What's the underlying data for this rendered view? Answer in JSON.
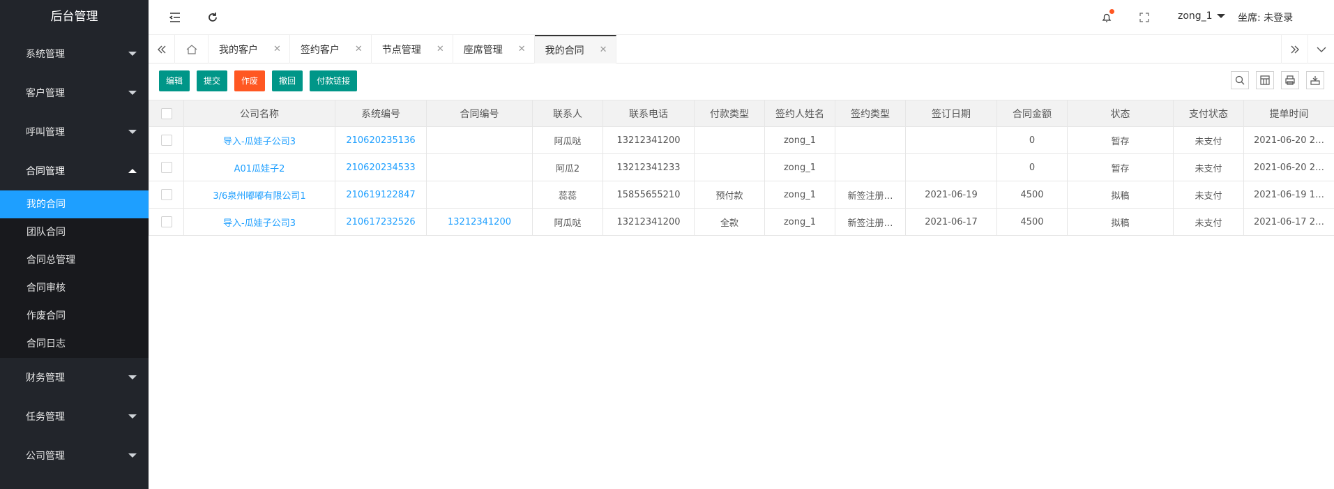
{
  "app": {
    "title": "后台管理"
  },
  "sidebar": {
    "groups": [
      {
        "label": "系统管理"
      },
      {
        "label": "客户管理"
      },
      {
        "label": "呼叫管理"
      },
      {
        "label": "合同管理"
      },
      {
        "label": "财务管理"
      },
      {
        "label": "任务管理"
      },
      {
        "label": "公司管理"
      }
    ],
    "contract_sub": [
      {
        "label": "我的合同"
      },
      {
        "label": "团队合同"
      },
      {
        "label": "合同总管理"
      },
      {
        "label": "合同审核"
      },
      {
        "label": "作废合同"
      },
      {
        "label": "合同日志"
      }
    ]
  },
  "header": {
    "user": "zong_1",
    "seat": "坐席: 未登录",
    "accent_color": "#ff5722"
  },
  "tabs": [
    {
      "label": "我的客户"
    },
    {
      "label": "签约客户"
    },
    {
      "label": "节点管理"
    },
    {
      "label": "座席管理"
    },
    {
      "label": "我的合同"
    }
  ],
  "toolbar": {
    "edit": "编辑",
    "submit": "提交",
    "void": "作废",
    "withdraw": "撤回",
    "pay_link": "付款链接"
  },
  "table": {
    "headers": [
      "公司名称",
      "系统编号",
      "合同编号",
      "联系人",
      "联系电话",
      "付款类型",
      "签约人姓名",
      "签约类型",
      "签订日期",
      "合同金额",
      "状态",
      "支付状态",
      "提单时间"
    ],
    "rows": [
      [
        "导入-瓜娃子公司3",
        "210620235136",
        "",
        "阿瓜哒",
        "13212341200",
        "",
        "zong_1",
        "",
        "",
        "0",
        "暂存",
        "未支付",
        "2021-06-20 2…"
      ],
      [
        "A01瓜娃子2",
        "210620234533",
        "",
        "阿瓜2",
        "13212341233",
        "",
        "zong_1",
        "",
        "",
        "0",
        "暂存",
        "未支付",
        "2021-06-20 2…"
      ],
      [
        "3/6泉州嘟嘟有限公司1",
        "210619122847",
        "",
        "蕊蕊",
        "15855655210",
        "预付款",
        "zong_1",
        "新签注册…",
        "2021-06-19",
        "4500",
        "拟稿",
        "未支付",
        "2021-06-19 1…"
      ],
      [
        "导入-瓜娃子公司3",
        "210617232526",
        "13212341200",
        "阿瓜哒",
        "13212341200",
        "全款",
        "zong_1",
        "新签注册…",
        "2021-06-17",
        "4500",
        "拟稿",
        "未支付",
        "2021-06-17 2…"
      ]
    ]
  },
  "colors": {
    "sidebar_bg": "#22252b",
    "active": "#1e9fff",
    "primary_btn": "#009688",
    "danger_btn": "#ff5722"
  }
}
